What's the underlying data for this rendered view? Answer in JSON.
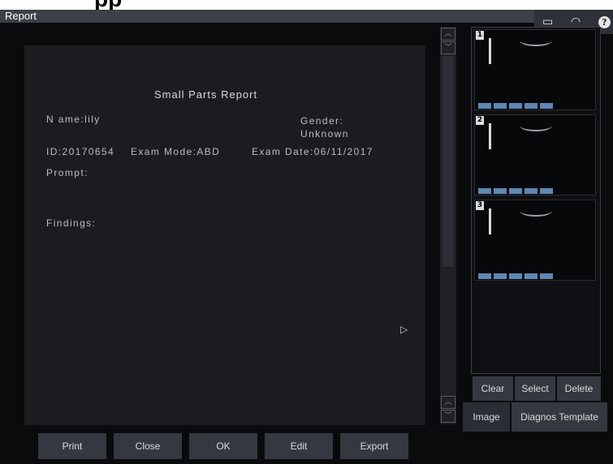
{
  "top_text": "pp",
  "window": {
    "title": "Report"
  },
  "tray": {
    "keyboard_icon": "keyboard-icon",
    "wifi_icon": "wifi-icon",
    "help_label": "?"
  },
  "report": {
    "title": "Small Parts Report",
    "name": "N ame:lily",
    "gender": "Gender:",
    "gender_value": "Unknown",
    "id": "ID:20170654",
    "exam_mode": "Exam Mode:ABD",
    "exam_date": "Exam Date:06/11/2017",
    "prompt": "Prompt:",
    "findings": "Findings:"
  },
  "thumbnails": {
    "items": [
      {
        "num": "1"
      },
      {
        "num": "2"
      },
      {
        "num": "3"
      }
    ]
  },
  "image_actions": {
    "clear": "Clear",
    "select": "Select",
    "delete": "Delete"
  },
  "side_tabs": {
    "image": "Image",
    "template": "Diagnos Template"
  },
  "bottom_buttons": {
    "print": "Print",
    "close": "Close",
    "ok": "OK",
    "edit": "Edit",
    "export": "Export"
  }
}
